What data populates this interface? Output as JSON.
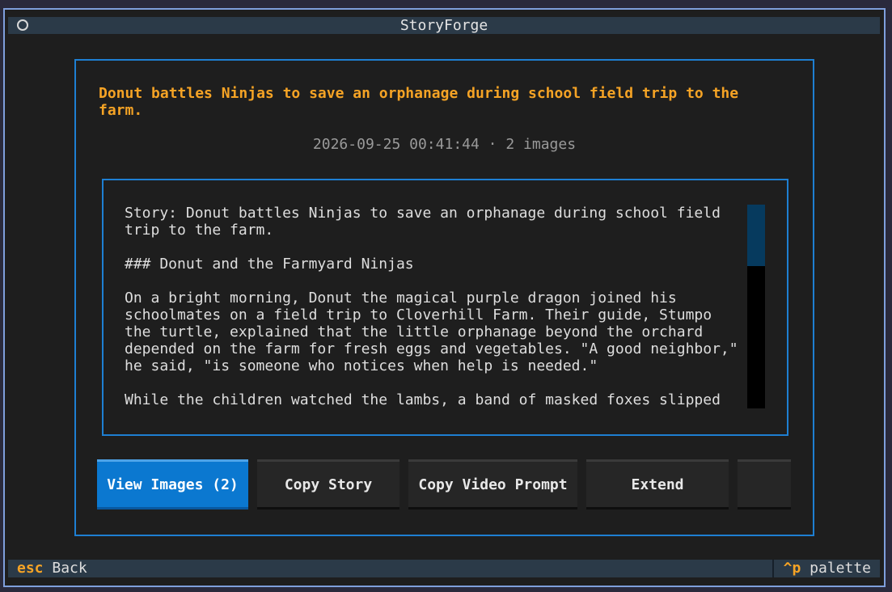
{
  "app": {
    "title": "StoryForge"
  },
  "story": {
    "title_line1": "Donut battles Ninjas to save an orphanage during school field trip to the",
    "title_line2": "farm.",
    "timestamp": "2026-09-25 00:41:44",
    "separator": "·",
    "image_count": "2 images",
    "body_lines": [
      "Story: Donut battles Ninjas to save an orphanage during school field",
      "trip to the farm.",
      "",
      "### Donut and the Farmyard Ninjas",
      "",
      "On a bright morning, Donut the magical purple dragon joined his",
      "schoolmates on a field trip to Cloverhill Farm. Their guide, Stumpo",
      "the turtle, explained that the little orphanage beyond the orchard",
      "depended on the farm for fresh eggs and vegetables. \"A good neighbor,\"",
      "he said, \"is someone who notices when help is needed.\"",
      "",
      "While the children watched the lambs, a band of masked foxes slipped"
    ],
    "scroll": {
      "position_fraction": 0.0,
      "visible_fraction": 0.3
    }
  },
  "actions": {
    "view_images": "View Images (2)",
    "copy_story": "Copy Story",
    "copy_video_prompt": "Copy Video Prompt",
    "extend": "Extend",
    "overflow": ""
  },
  "footer": {
    "back_key": "esc",
    "back_label": "Back",
    "palette_key": "^p",
    "palette_label": "palette"
  },
  "colors": {
    "accent": "#f5a325",
    "primary": "#0b78d0",
    "border": "#1e7fd2",
    "scroll_thumb": "#063a5e"
  }
}
